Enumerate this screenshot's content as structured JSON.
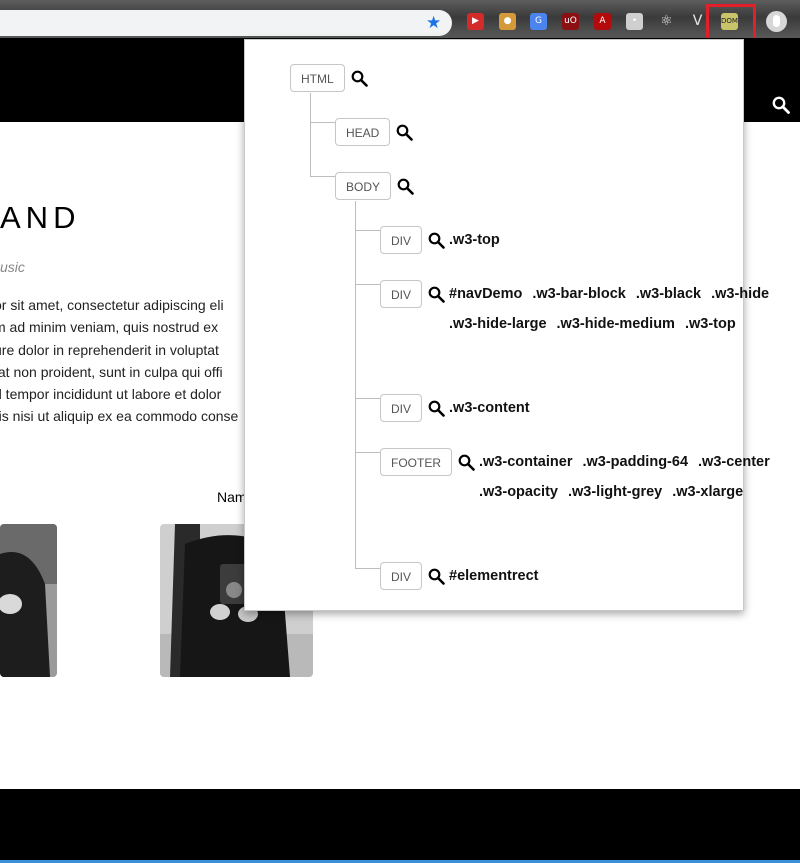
{
  "browser": {
    "extensions": [
      {
        "name": "youtube-extension",
        "color": "#d32a2a",
        "glyph": "▶"
      },
      {
        "name": "cookie-extension",
        "color": "#d49a3a",
        "glyph": "●"
      },
      {
        "name": "translate-extension",
        "color": "#4a84ec",
        "glyph": "G"
      },
      {
        "name": "ublock-extension",
        "color": "#8b1014",
        "glyph": "uO"
      },
      {
        "name": "pdf-extension",
        "color": "#b30b0b",
        "glyph": "A"
      },
      {
        "name": "line-extension",
        "color": "#cfcfcf",
        "glyph": "•"
      },
      {
        "name": "react-devtools-extension",
        "color": "transparent",
        "glyph": "⚛"
      },
      {
        "name": "vue-devtools-extension",
        "color": "transparent",
        "glyph": "V"
      },
      {
        "name": "dom-tree-extension",
        "color": "#c9c36a",
        "glyph": "DOM"
      }
    ]
  },
  "page": {
    "title": "AND",
    "subtitle": "usic",
    "text_lines": [
      "or sit amet, consectetur adipiscing eli",
      "m ad minim veniam, quis nostrud ex",
      "ure dolor in reprehenderit in voluptat",
      "tat non proident, sunt in culpa qui offi",
      "d tempor incididunt ut labore et dolor",
      "ris nisi ut aliquip ex ea commodo conse"
    ],
    "name_label": "Nam"
  },
  "dom_tree": {
    "html": {
      "tag": "HTML"
    },
    "head": {
      "tag": "HEAD"
    },
    "body": {
      "tag": "BODY"
    },
    "children": [
      {
        "tag": "DIV",
        "attrs": [
          ".w3-top"
        ]
      },
      {
        "tag": "DIV",
        "attrs": [
          "#navDemo",
          ".w3-bar-block",
          ".w3-black",
          ".w3-hide",
          ".w3-hide-large",
          ".w3-hide-medium",
          ".w3-top"
        ]
      },
      {
        "tag": "DIV",
        "attrs": [
          ".w3-content"
        ]
      },
      {
        "tag": "FOOTER",
        "attrs": [
          ".w3-container",
          ".w3-padding-64",
          ".w3-center",
          ".w3-opacity",
          ".w3-light-grey",
          ".w3-xlarge"
        ]
      },
      {
        "tag": "DIV",
        "attrs": [
          "#elementrect"
        ]
      }
    ]
  }
}
